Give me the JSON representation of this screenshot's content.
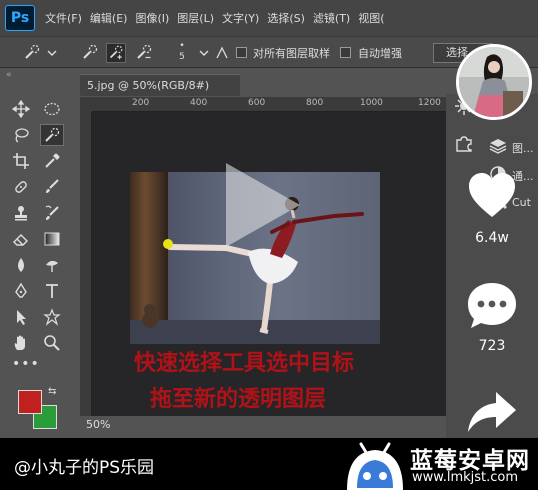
{
  "app": {
    "logo": "Ps",
    "menu": [
      "文件(F)",
      "编辑(E)",
      "图像(I)",
      "图层(L)",
      "文字(Y)",
      "选择(S)",
      "滤镜(T)",
      "视图("
    ]
  },
  "options_bar": {
    "brush_size": "5",
    "sample_all_layers_label": "对所有图层取样",
    "auto_enhance_label": "自动增强",
    "select_button_label": "选择"
  },
  "document": {
    "tab_title": "5.jpg @ 50%(RGB/8#)",
    "ruler_top_labels": [
      "200",
      "400",
      "600",
      "800",
      "1000",
      "1200"
    ],
    "zoom": "50%"
  },
  "subtitle": {
    "line1": "快速选择工具选中目标",
    "line2": "拖至新的透明图层"
  },
  "right_panel": {
    "items": [
      "图...",
      "通...",
      "Cut"
    ]
  },
  "social": {
    "likes": "6.4w",
    "comments": "723"
  },
  "caption": "@小丸子的PS乐园",
  "watermark": {
    "name": "蓝莓安卓网",
    "url": "www.lmkjst.com"
  },
  "colors": {
    "foreground": "#c0201e",
    "background": "#2b9c3a",
    "subtitle": "#b01218",
    "ps_accent": "#31a8ff",
    "watermark_brand": "#3b7bd8"
  }
}
